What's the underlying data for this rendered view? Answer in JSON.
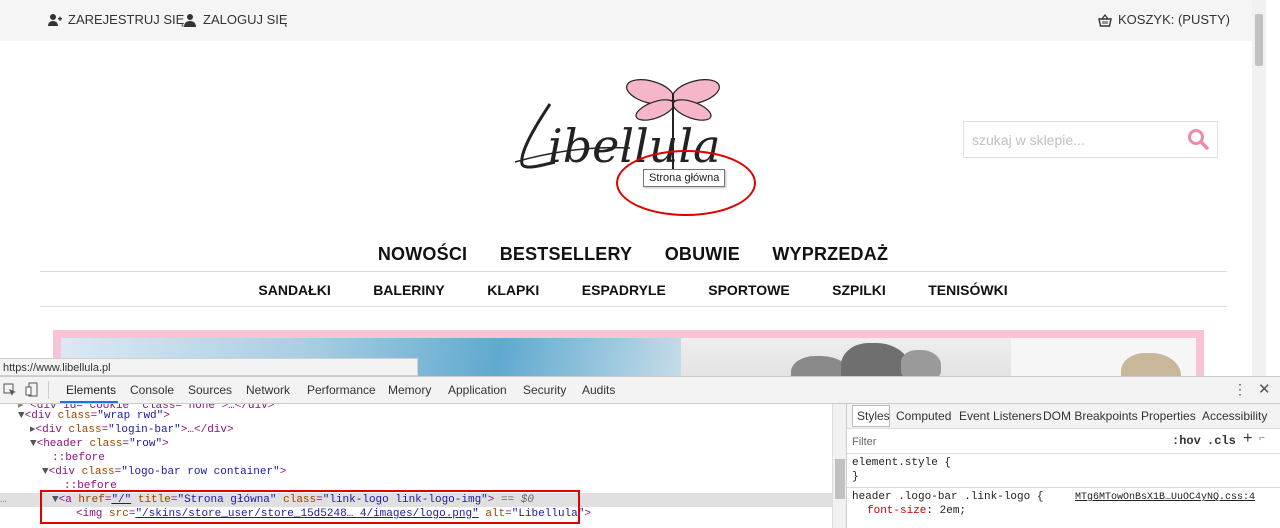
{
  "site": {
    "top": {
      "register": "ZAREJESTRUJ SIĘ",
      "login": "ZALOGUJ SIĘ",
      "cart": "KOSZYK: (PUSTY)"
    },
    "logo_tooltip": "Strona główna",
    "search": {
      "placeholder": "szukaj w sklepie..."
    },
    "nav_main": [
      "NOWOŚCI",
      "BESTSELLERY",
      "OBUWIE",
      "WYPRZEDAŻ"
    ],
    "nav_sub": [
      "SANDAŁKI",
      "BALERINY",
      "KLAPKI",
      "ESPADRYLE",
      "SPORTOWE",
      "SZPILKI",
      "TENISÓWKI"
    ],
    "status_url": "https://www.libellula.pl"
  },
  "devtools": {
    "tabs": [
      "Elements",
      "Console",
      "Sources",
      "Network",
      "Performance",
      "Memory",
      "Application",
      "Security",
      "Audits"
    ],
    "active_tab": "Elements",
    "dom": {
      "l0": "<div id=\"cookie\" class=\"none\">…</div>",
      "l1_tag": "<div",
      "l1_attr": "class",
      "l1_val": "\"wrap rwd\"",
      "l2_tag": "<div",
      "l2_attr": "class",
      "l2_val": "\"login-bar\"",
      "l2_rest": ">…</div>",
      "l3_tag": "<header",
      "l3_attr": "class",
      "l3_val": "\"row\"",
      "l4": "::before",
      "l5_tag": "<div",
      "l5_attr": "class",
      "l5_val": "\"logo-bar row container\"",
      "l6": "::before",
      "l7_tag": "<a",
      "l7_href_attr": "href",
      "l7_href_val": "\"/\"",
      "l7_title_attr": "title",
      "l7_title_val": "\"Strona główna\"",
      "l7_class_attr": "class",
      "l7_class_val": "\"link-logo link-logo-img\"",
      "l7_eq": "== $0",
      "l8_tag": "<img",
      "l8_src_attr": "src",
      "l8_src_val": "\"/skins/store_user/store_15d5248… 4/images/logo.png\"",
      "l8_alt_attr": "alt",
      "l8_alt_val": "\"Libellula\""
    },
    "styles_tabs": [
      "Styles",
      "Computed",
      "Event Listeners",
      "DOM Breakpoints",
      "Properties",
      "Accessibility"
    ],
    "filter_placeholder": "Filter",
    "hov": ":hov",
    "cls": ".cls",
    "element_style": "element.style {",
    "close_brace": "}",
    "rule_selector": "header .logo-bar .link-logo {",
    "rule_source": "MTg6MTowOnBsX1B…UuOC4yNQ.css:4",
    "rule_prop": "font-size",
    "rule_value": "2em;"
  }
}
